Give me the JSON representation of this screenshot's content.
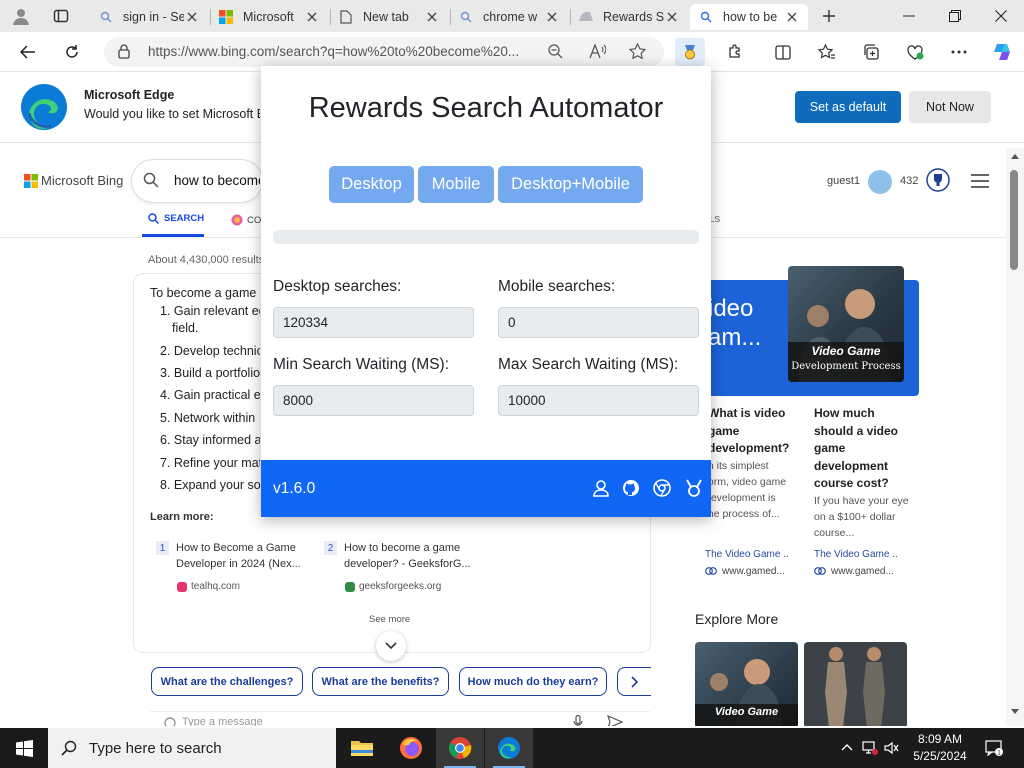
{
  "browser": {
    "tabs": [
      {
        "label": "sign in - Se",
        "icon": "search-icon"
      },
      {
        "label": "Microsoft",
        "icon": "microsoft-icon"
      },
      {
        "label": "New tab",
        "icon": "page-icon"
      },
      {
        "label": "chrome w",
        "icon": "search-icon"
      },
      {
        "label": "Rewards S",
        "icon": "rewards-icon"
      },
      {
        "label": "how to be",
        "icon": "search-icon",
        "active": true
      }
    ],
    "url": "https://www.bing.com/search?q=how%20to%20become%20..."
  },
  "banner": {
    "title": "Microsoft Edge",
    "message": "Would you like to set Microsoft Edge",
    "primary_button": "Set as default",
    "secondary_button": "Not Now"
  },
  "bing": {
    "logo": "Microsoft Bing",
    "query": "how to become a game developer",
    "scope_search": "SEARCH",
    "scope_copilot": "CO",
    "scope_tools": "OLS",
    "user": "guest1",
    "points": "432",
    "results_count": "About 4,430,000 results",
    "answer_intro": "To become a game",
    "steps": [
      "1. Gain relevant ed",
      "2. Develop technic",
      "3. Build a portfolio",
      "4. Gain practical e",
      "5. Network within",
      "6. Stay informed a",
      "7. Refine your mat",
      "8. Expand your so"
    ],
    "step1_cont": "field.",
    "learn_more": "Learn more:",
    "sources": [
      {
        "num": "1",
        "title": "How to Become a Game Developer in 2024 (Nex...",
        "site": "tealhq.com"
      },
      {
        "num": "2",
        "title": "How to become a game developer? - GeeksforG...",
        "site": "geeksforgeeks.org"
      }
    ],
    "see_more": "See more",
    "chips": [
      "What are the challenges?",
      "What are the benefits?",
      "How much do they earn?"
    ],
    "message_placeholder": "Type a message"
  },
  "side_panel": {
    "hero_text": "ideo\nam...",
    "hero_image_caption": "Video Game",
    "hero_image_sub": "Development Process",
    "questions": [
      {
        "title": "What is video game development?",
        "body": "In its simplest form, video game development is the process of...",
        "source": "The Video Game ...",
        "url": "www.gamed..."
      },
      {
        "title": "How much should a video game development course cost?",
        "body": "If you have your eye on a $100+ dollar course...",
        "source": "The Video Game ...",
        "url": "www.gamed..."
      }
    ],
    "explore_more": "Explore More",
    "explore_image_caption": "Video Game"
  },
  "popup": {
    "title": "Rewards Search Automator",
    "mode_buttons": [
      "Desktop",
      "Mobile",
      "Desktop+Mobile"
    ],
    "progress_fraction": 0.0,
    "desktop_label": "Desktop searches:",
    "desktop_value": "120334",
    "mobile_label": "Mobile searches:",
    "mobile_value": "0",
    "min_wait_label": "Min Search Waiting (MS):",
    "min_wait_value": "8000",
    "max_wait_label": "Max Search Waiting (MS):",
    "max_wait_value": "10000",
    "version": "v1.6.0",
    "footer_icons": [
      "profile-icon",
      "github-icon",
      "chrome-icon",
      "medal-icon"
    ]
  },
  "taskbar": {
    "search_placeholder": "Type here to search",
    "apps": [
      "file-explorer-icon",
      "firefox-icon",
      "chrome-icon",
      "edge-icon"
    ],
    "time": "8:09 AM",
    "date": "5/25/2024"
  },
  "colors": {
    "popup_blue": "#1066f5",
    "mode_button": "#74a9f0",
    "edge_primary": "#0f6cbd",
    "bing_accent": "#174ae4"
  }
}
